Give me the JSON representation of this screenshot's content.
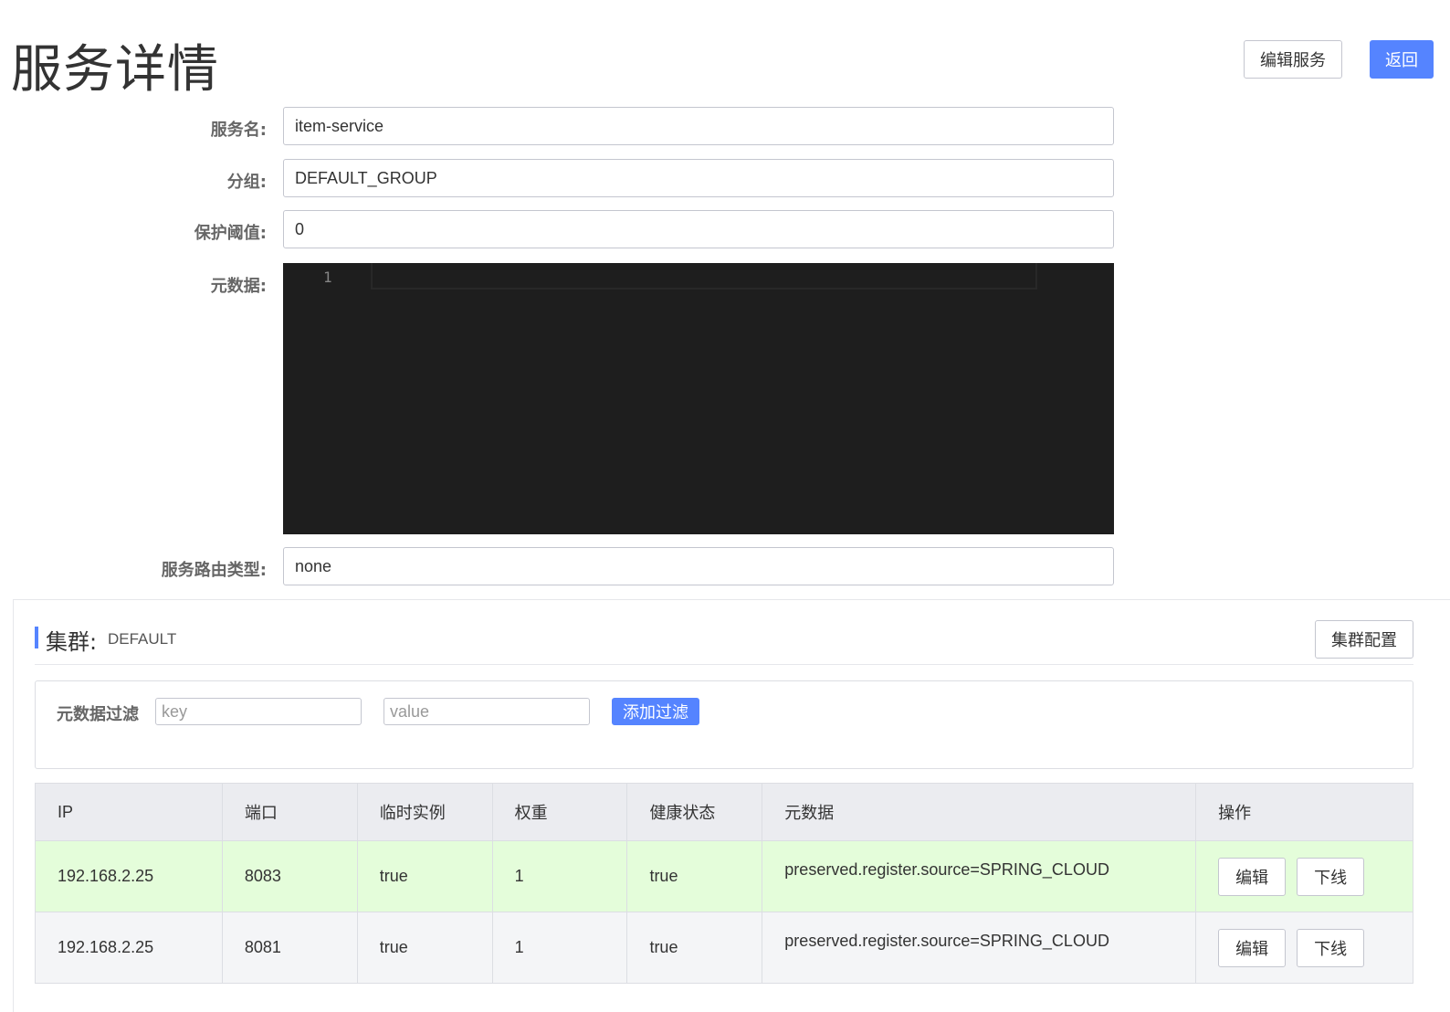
{
  "page": {
    "title": "服务详情",
    "edit_service_label": "编辑服务",
    "back_label": "返回"
  },
  "form": {
    "service_name_label": "服务名:",
    "service_name_value": "item-service",
    "group_label": "分组:",
    "group_value": "DEFAULT_GROUP",
    "threshold_label": "保护阈值:",
    "threshold_value": "0",
    "metadata_label": "元数据:",
    "metadata_line_number": "1",
    "selector_label": "服务路由类型:",
    "selector_value": "none"
  },
  "cluster": {
    "title": "集群:",
    "name": "DEFAULT",
    "config_label": "集群配置",
    "filter": {
      "label": "元数据过滤",
      "key_placeholder": "key",
      "value_placeholder": "value",
      "add_label": "添加过滤"
    },
    "table": {
      "headers": [
        "IP",
        "端口",
        "临时实例",
        "权重",
        "健康状态",
        "元数据",
        "操作"
      ],
      "rows": [
        {
          "ip": "192.168.2.25",
          "port": "8083",
          "ephemeral": "true",
          "weight": "1",
          "healthy": "true",
          "metadata": "preserved.register.source=SPRING_CLOUD",
          "edit_label": "编辑",
          "offline_label": "下线"
        },
        {
          "ip": "192.168.2.25",
          "port": "8081",
          "ephemeral": "true",
          "weight": "1",
          "healthy": "true",
          "metadata": "preserved.register.source=SPRING_CLOUD",
          "edit_label": "编辑",
          "offline_label": "下线"
        }
      ]
    }
  },
  "colors": {
    "primary": "#5584ff",
    "healthy_row": "#e4fdda",
    "editor_bg": "#1e1e1e"
  }
}
